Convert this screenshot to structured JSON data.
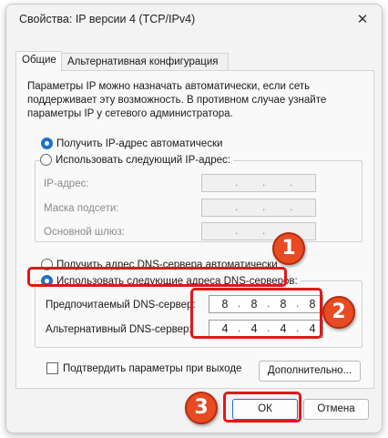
{
  "window": {
    "title": "Свойства: IP версии 4 (TCP/IPv4)",
    "close_glyph": "✕"
  },
  "tabs": [
    {
      "label": "Общие",
      "active": true
    },
    {
      "label": "Альтернативная конфигурация",
      "active": false
    }
  ],
  "description": "Параметры IP можно назначать автоматически, если сеть поддерживает эту возможность. В противном случае узнайте параметры IP у сетевого администратора.",
  "ip_section": {
    "auto_label": "Получить IP-адрес автоматически",
    "auto_selected": true,
    "manual_label": "Использовать следующий IP-адрес:",
    "manual_selected": false,
    "fields": [
      {
        "label": "IP-адрес:",
        "value": [
          "",
          "",
          "",
          ""
        ]
      },
      {
        "label": "Маска подсети:",
        "value": [
          "",
          "",
          "",
          ""
        ]
      },
      {
        "label": "Основной шлюз:",
        "value": [
          "",
          "",
          "",
          ""
        ]
      }
    ]
  },
  "dns_section": {
    "auto_label": "Получить адрес DNS-сервера автоматически",
    "auto_selected": false,
    "manual_label": "Использовать следующие адреса DNS-серверов:",
    "manual_selected": true,
    "preferred_label": "Предпочитаемый DNS-сервер:",
    "preferred_value": [
      "8",
      "8",
      "8",
      "8"
    ],
    "alternate_label": "Альтернативный DNS-сервер:",
    "alternate_value": [
      "4",
      "4",
      "4",
      "4"
    ]
  },
  "validate_label": "Подтвердить параметры при выходе",
  "advanced_label": "Дополнительно...",
  "ok_label": "ОК",
  "cancel_label": "Отмена",
  "annotations": {
    "step1": "1",
    "step2": "2",
    "step3": "3",
    "highlight_color": "#e01818",
    "badge_color": "#e84b22"
  },
  "colors": {
    "accent": "#1a73c9"
  }
}
